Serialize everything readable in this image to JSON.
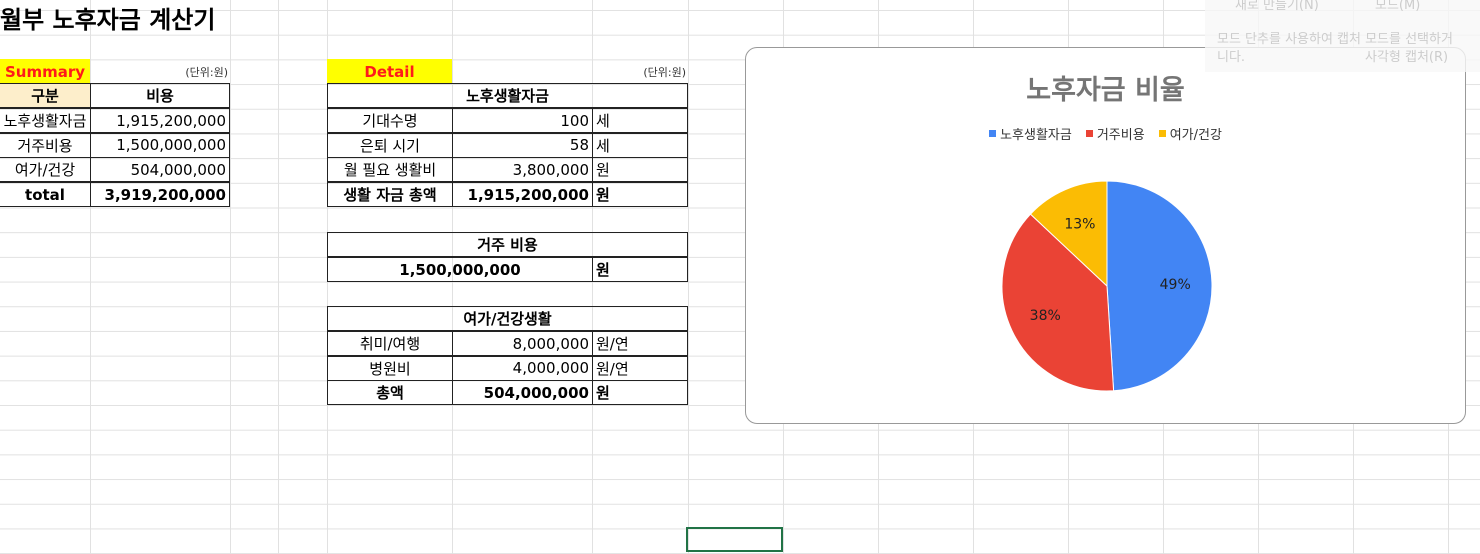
{
  "title": "월부 노후자금 계산기",
  "summary": {
    "label": "Summary",
    "unit": "(단위:원)",
    "headers": [
      "구분",
      "비용"
    ],
    "rows": [
      [
        "노후생활자금",
        "1,915,200,000"
      ],
      [
        "거주비용",
        "1,500,000,000"
      ],
      [
        "여가/건강",
        "504,000,000"
      ]
    ],
    "total": [
      "total",
      "3,919,200,000"
    ]
  },
  "detail": {
    "label": "Detail",
    "unit": "(단위:원)",
    "living": {
      "header": "노후생활자금",
      "rows": [
        [
          "기대수명",
          "100",
          "세"
        ],
        [
          "은퇴 시기",
          "58",
          "세"
        ],
        [
          "월 필요 생활비",
          "3,800,000",
          "원"
        ]
      ],
      "total": [
        "생활 자금 총액",
        "1,915,200,000",
        "원"
      ]
    },
    "housing": {
      "header": "거주 비용",
      "value": "1,500,000,000",
      "unit": "원"
    },
    "leisure": {
      "header": "여가/건강생활",
      "rows": [
        [
          "취미/여행",
          "8,000,000",
          "원/연"
        ],
        [
          "병원비",
          "4,000,000",
          "원/연"
        ]
      ],
      "total": [
        "총액",
        "504,000,000",
        "원"
      ]
    }
  },
  "snip": {
    "new": "새로 만들기(N)",
    "mode": "모드(M)",
    "hint1": "모드 단추를 사용하여 캡처 모드를 선택하거",
    "hint2": "니다.",
    "rect": "사각형 캡처(R)"
  },
  "chart_data": {
    "type": "pie",
    "title": "노후자금 비율",
    "categories": [
      "노후생활자금",
      "거주비용",
      "여가/건강"
    ],
    "values": [
      49,
      38,
      13
    ],
    "labels": [
      "49%",
      "38%",
      "13%"
    ],
    "colors": [
      "#4285f4",
      "#ea4335",
      "#fbbc04"
    ],
    "legend": "top"
  }
}
